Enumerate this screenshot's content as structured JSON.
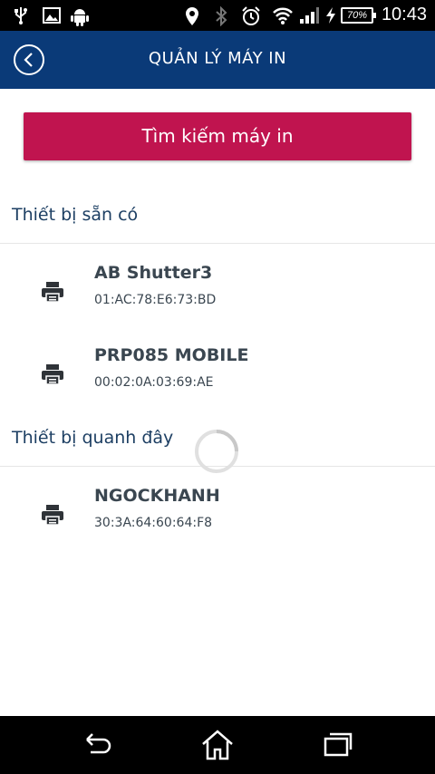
{
  "status_bar": {
    "time": "10:43",
    "battery": "70%",
    "icons": [
      "usb-icon",
      "image-icon",
      "android-icon",
      "location-icon",
      "bluetooth-icon",
      "alarm-icon",
      "wifi-icon",
      "signal-icon",
      "charging-icon"
    ]
  },
  "header": {
    "title": "QUẢN LÝ MÁY IN",
    "back_icon": "back-circle-icon"
  },
  "search_button": {
    "label": "Tìm kiếm máy in",
    "color": "#c0144f"
  },
  "sections": {
    "available": {
      "title": "Thiết bị sẵn có",
      "devices": [
        {
          "name": "AB Shutter3",
          "address": "01:AC:78:E6:73:BD"
        },
        {
          "name": "PRP085 MOBILE",
          "address": "00:02:0A:03:69:AE"
        }
      ]
    },
    "nearby": {
      "title": "Thiết bị quanh đây",
      "devices": [
        {
          "name": "NGOCKHANH",
          "address": "30:3A:64:60:64:F8"
        }
      ]
    }
  },
  "nav_bar": {
    "icons": [
      "back-icon",
      "home-icon",
      "recents-icon"
    ]
  },
  "colors": {
    "header": "#0a3a78",
    "accent": "#c0144f",
    "section_title": "#1d3f63"
  }
}
